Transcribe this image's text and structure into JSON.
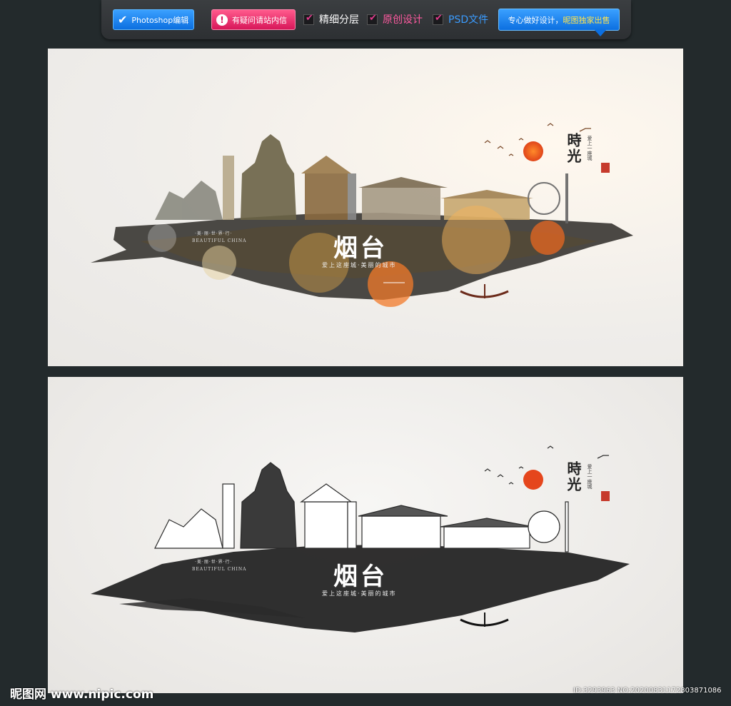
{
  "toolbar": {
    "photoshop_label": "Photoshop编辑",
    "question_label": "有疑问请站内信",
    "features": [
      {
        "label": "精细分层",
        "color": "#ffffff"
      },
      {
        "label": "原创设计",
        "color": "#ff5aa0"
      },
      {
        "label": "PSD文件",
        "color": "#3a9cff"
      }
    ],
    "promo_prefix": "专心做好设计，",
    "promo_highlight": "昵图独家出售"
  },
  "posters": [
    {
      "city": "烟台",
      "tagline": "爱上这座城·美丽的城市",
      "small_title": "·美·丽·世·界·行·",
      "english": "BEAUTIFUL CHINA",
      "side_title": "時光",
      "side_small": "爱上一座城",
      "variant": "color"
    },
    {
      "city": "烟台",
      "tagline": "爱上这座城·美丽的城市",
      "small_title": "·美·丽·世·界·行·",
      "english": "BEAUTIFUL CHINA",
      "side_title": "時光",
      "side_small": "爱上一座城",
      "variant": "mono"
    }
  ],
  "watermark": {
    "logo": "昵图网 www.nipic.com",
    "id": "ID:3293963 NO:20200831172803871086"
  }
}
